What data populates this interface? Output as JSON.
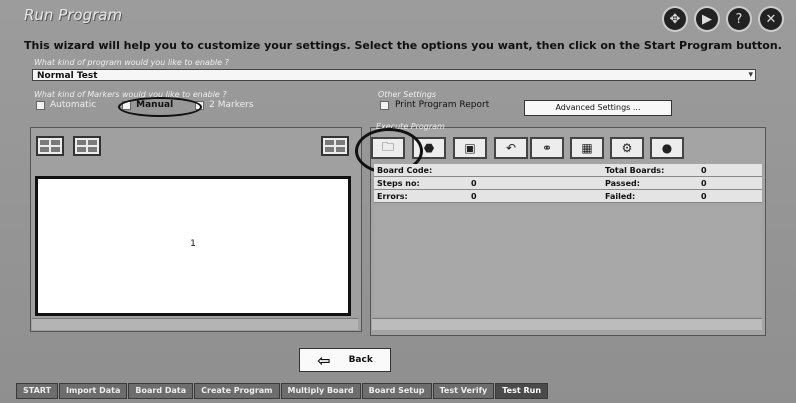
{
  "window": {
    "title": "Run Program",
    "wizard_text": "This wizard will help you to customize your settings. Select the options you want, then click on the Start Program button."
  },
  "program_kind": {
    "label": "What kind of program would you like to enable ?",
    "selected": "Normal Test"
  },
  "markers": {
    "label": "What kind of Markers would you like to enable ?",
    "options": [
      "Automatic",
      "Manual",
      "2 Markers"
    ]
  },
  "other_settings": {
    "label": "Other Settings",
    "print_report": "Print Program Report",
    "advanced_button": "Advanced Settings ..."
  },
  "execute": {
    "label": "Execute Program"
  },
  "canvas": {
    "value": "1"
  },
  "info": {
    "board_code_label": "Board Code:",
    "board_code_value": "",
    "total_boards_label": "Total Boards:",
    "total_boards_value": "0",
    "steps_label": "Steps no:",
    "steps_value": "0",
    "passed_label": "Passed:",
    "passed_value": "0",
    "errors_label": "Errors:",
    "errors_value": "0",
    "failed_label": "Failed:",
    "failed_value": "0"
  },
  "back_button": "Back",
  "tabs": [
    "START",
    "Import Data",
    "Board Data",
    "Create Program",
    "Multiply Board",
    "Board Setup",
    "Test Verify",
    "Test Run"
  ],
  "icons": {
    "title": [
      "move-icon",
      "play-icon",
      "help-icon",
      "close-icon"
    ],
    "tools": [
      "folder-icon",
      "stop-icon",
      "board-icon",
      "undo-icon",
      "markers-icon",
      "chip-icon",
      "gear-icon",
      "disk-icon"
    ]
  }
}
